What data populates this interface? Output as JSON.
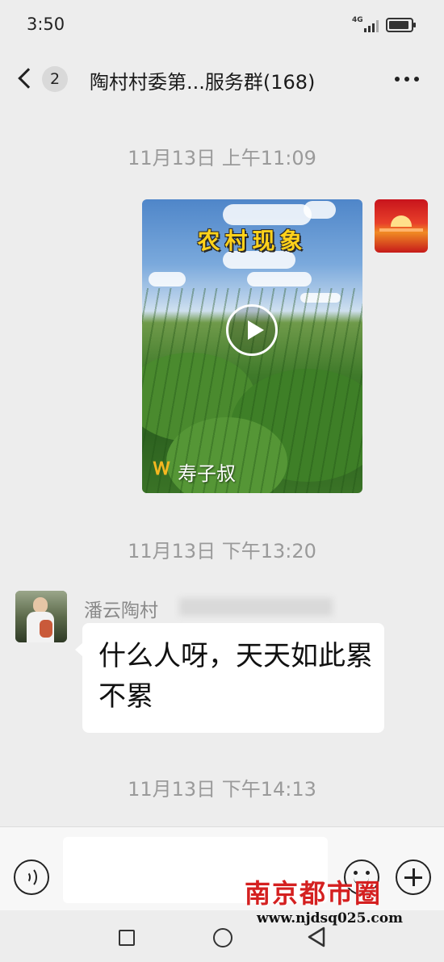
{
  "status_bar": {
    "time": "3:50",
    "network": "4G"
  },
  "header": {
    "unread_count": "2",
    "title": "陶村村委第...服务群(168)"
  },
  "messages": [
    {
      "type": "timestamp",
      "text": "11月13日 上午11:09"
    },
    {
      "type": "video",
      "side": "right",
      "video_title": "农村现象",
      "channel_name": "寿子叔",
      "avatar_icon": "news-sunset-avatar"
    },
    {
      "type": "timestamp",
      "text": "11月13日 下午13:20"
    },
    {
      "type": "text",
      "side": "left",
      "sender": "潘云陶村",
      "text": "什么人呀，天天如此累不累",
      "avatar_icon": "user-photo-avatar"
    },
    {
      "type": "timestamp",
      "text": "11月13日 下午14:13"
    }
  ],
  "input_bar": {
    "value": "",
    "placeholder": ""
  },
  "watermark": {
    "logo": "南京都市圈",
    "url": "www.njdsq025.com"
  },
  "colors": {
    "background": "#ededed",
    "bubble": "#ffffff",
    "timestamp": "#9a9a9a",
    "watermark_red": "#d42020"
  }
}
